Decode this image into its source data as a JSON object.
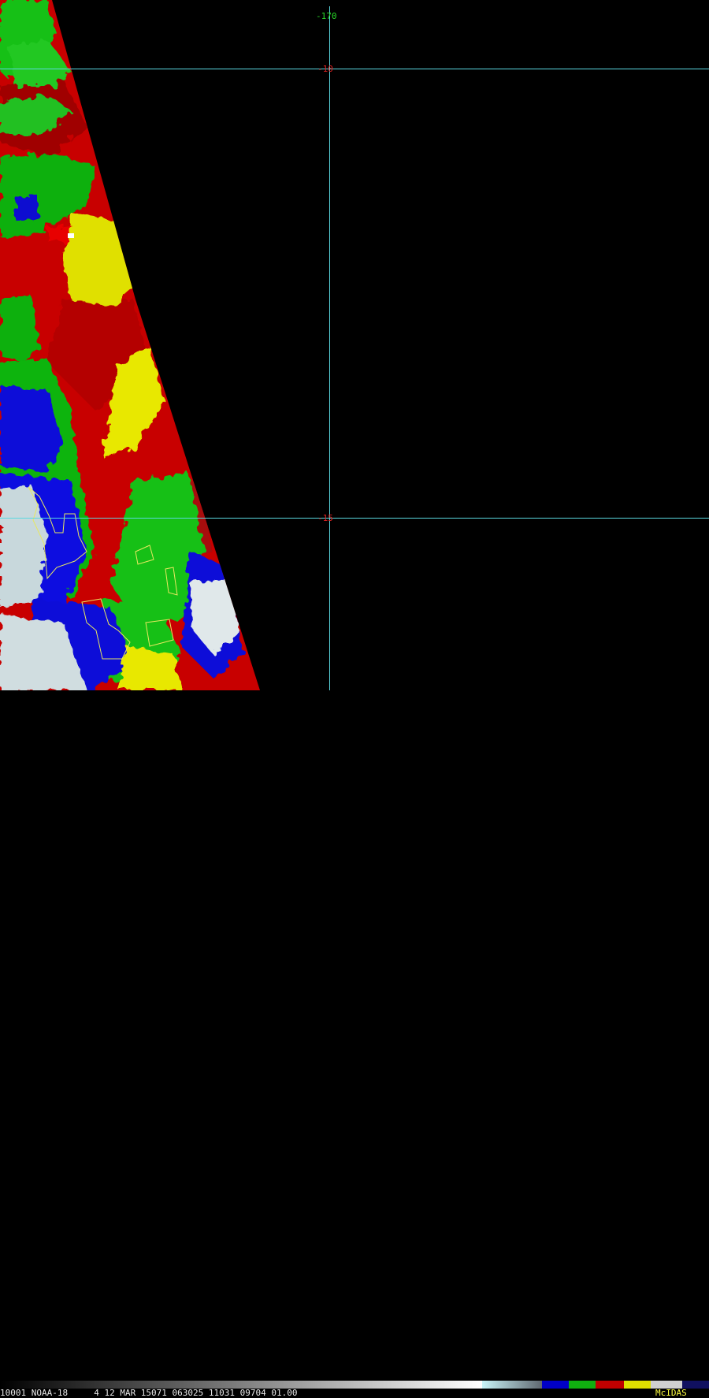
{
  "grid": {
    "longitude_label": "-170",
    "latitude_labels": [
      "-10",
      "-15"
    ],
    "longitude_label_color": "#28d828",
    "latitude_label_color": "#e02020",
    "gridline_color": "#5ad8e0"
  },
  "status_bar": {
    "text": "10001 NOAA-18     4 12 MAR 15071 063025 11031 09704 01.00",
    "brand": "McIDAS",
    "brand_color": "#ffff40"
  },
  "colors": {
    "background": "#000000",
    "enhancement": [
      "#ffffff",
      "#b0e8ec",
      "#0000e0",
      "#10c010",
      "#d00000",
      "#e8e800"
    ]
  }
}
